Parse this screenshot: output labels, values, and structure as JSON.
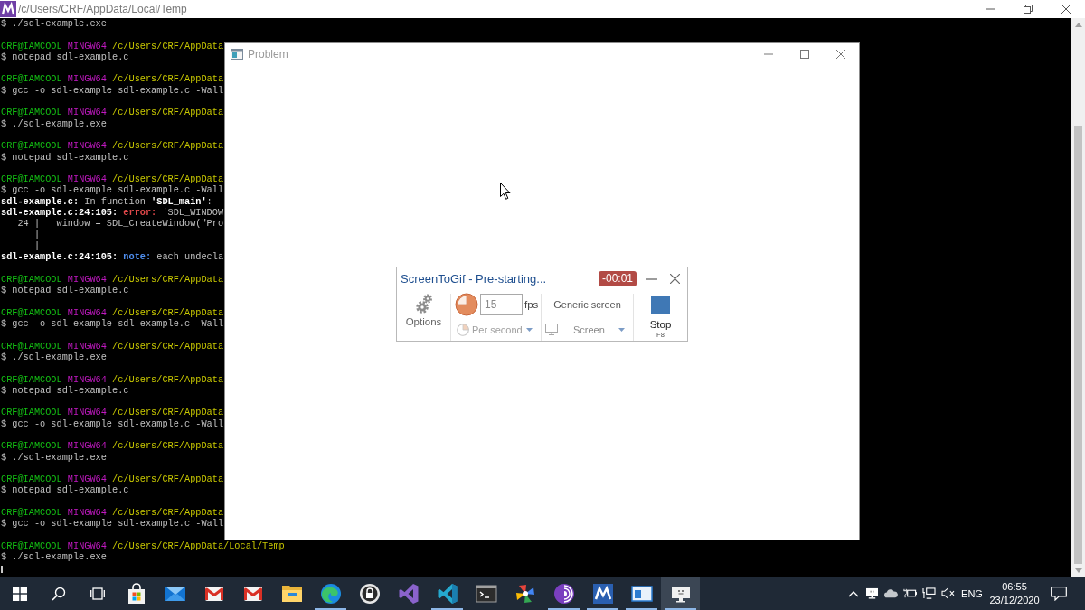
{
  "terminal": {
    "title": "/c/Users/CRF/AppData/Local/Temp",
    "blocks": [
      {
        "command": "$ ./sdl-example.exe"
      },
      {
        "prompt": {
          "user": "CRF@IAMCOOL",
          "host": "MINGW64",
          "path": "/c/Users/CRF/AppData"
        },
        "command": "$ notepad sdl-example.c"
      },
      {
        "prompt": {
          "user": "CRF@IAMCOOL",
          "host": "MINGW64",
          "path": "/c/Users/CRF/AppData"
        },
        "command": "$ gcc -o sdl-example sdl-example.c -Wall"
      },
      {
        "prompt": {
          "user": "CRF@IAMCOOL",
          "host": "MINGW64",
          "path": "/c/Users/CRF/AppData"
        },
        "command": "$ ./sdl-example.exe"
      },
      {
        "prompt": {
          "user": "CRF@IAMCOOL",
          "host": "MINGW64",
          "path": "/c/Users/CRF/AppData"
        },
        "command": "$ notepad sdl-example.c"
      },
      {
        "prompt": {
          "user": "CRF@IAMCOOL",
          "host": "MINGW64",
          "path": "/c/Users/CRF/AppData"
        },
        "command": "$ gcc -o sdl-example sdl-example.c -Wall",
        "output": [
          {
            "kind": "plain",
            "text": "**sdl-example.c:** In function **'SDL_main'**:"
          },
          {
            "kind": "error",
            "location": "sdl-example.c:24:105:",
            "label": "error:",
            "message": "'SDL_WINDOW"
          },
          {
            "kind": "plain",
            "text": "   24 |   window = SDL_CreateWindow(\"Pro"
          },
          {
            "kind": "plain",
            "text": "      |"
          },
          {
            "kind": "plain",
            "text": "      |"
          },
          {
            "kind": "note",
            "location": "sdl-example.c:24:105:",
            "label": "note:",
            "message": "each undecla"
          }
        ]
      },
      {
        "prompt": {
          "user": "CRF@IAMCOOL",
          "host": "MINGW64",
          "path": "/c/Users/CRF/AppData"
        },
        "command": "$ notepad sdl-example.c"
      },
      {
        "prompt": {
          "user": "CRF@IAMCOOL",
          "host": "MINGW64",
          "path": "/c/Users/CRF/AppData"
        },
        "command": "$ gcc -o sdl-example sdl-example.c -Wall"
      },
      {
        "prompt": {
          "user": "CRF@IAMCOOL",
          "host": "MINGW64",
          "path": "/c/Users/CRF/AppData"
        },
        "command": "$ ./sdl-example.exe"
      },
      {
        "prompt": {
          "user": "CRF@IAMCOOL",
          "host": "MINGW64",
          "path": "/c/Users/CRF/AppData"
        },
        "command": "$ notepad sdl-example.c"
      },
      {
        "prompt": {
          "user": "CRF@IAMCOOL",
          "host": "MINGW64",
          "path": "/c/Users/CRF/AppData"
        },
        "command": "$ gcc -o sdl-example sdl-example.c -Wall"
      },
      {
        "prompt": {
          "user": "CRF@IAMCOOL",
          "host": "MINGW64",
          "path": "/c/Users/CRF/AppData"
        },
        "command": "$ ./sdl-example.exe"
      },
      {
        "prompt": {
          "user": "CRF@IAMCOOL",
          "host": "MINGW64",
          "path": "/c/Users/CRF/AppData"
        },
        "command": "$ notepad sdl-example.c"
      },
      {
        "prompt": {
          "user": "CRF@IAMCOOL",
          "host": "MINGW64",
          "path": "/c/Users/CRF/AppData"
        },
        "command": "$ gcc -o sdl-example sdl-example.c -Wall"
      },
      {
        "prompt": {
          "user": "CRF@IAMCOOL",
          "host": "MINGW64",
          "path": "/c/Users/CRF/AppData/Local/Temp"
        },
        "command": "$ ./sdl-example.exe"
      }
    ]
  },
  "problem_window": {
    "title": "Problem"
  },
  "recorder": {
    "title": "ScreenToGif - Pre-starting...",
    "timer": "-00:01",
    "options_label": "Options",
    "fps_value": "15",
    "fps_unit": "fps",
    "frequency": "Per second",
    "screen_name": "Generic screen",
    "region_mode": "Screen",
    "stop_label": "Stop",
    "stop_shortcut": "F8"
  },
  "taskbar": {
    "apps": [
      {
        "kind": "bag",
        "running": false,
        "selected": false
      },
      {
        "kind": "envelope",
        "running": false,
        "selected": false
      },
      {
        "kind": "m-envelope",
        "running": false,
        "selected": false
      },
      {
        "kind": "m-envelope",
        "running": false,
        "selected": false
      },
      {
        "kind": "folder",
        "running": false,
        "selected": false
      },
      {
        "kind": "wave",
        "running": true,
        "selected": false
      },
      {
        "kind": "padlock",
        "running": false,
        "selected": false
      },
      {
        "kind": "ribbon",
        "running": false,
        "selected": false
      },
      {
        "kind": "angle",
        "running": true,
        "selected": false
      },
      {
        "kind": "prompt",
        "running": false,
        "selected": false
      },
      {
        "kind": "pinwheel",
        "running": false,
        "selected": false
      },
      {
        "kind": "onion",
        "running": true,
        "selected": false
      },
      {
        "kind": "m-tile",
        "running": true,
        "selected": false
      },
      {
        "kind": "window",
        "running": true,
        "selected": false
      },
      {
        "kind": "monitor",
        "running": true,
        "selected": true
      }
    ],
    "tray": {
      "language": "ENG",
      "time": "06:55",
      "date": "23/12/2020"
    }
  }
}
